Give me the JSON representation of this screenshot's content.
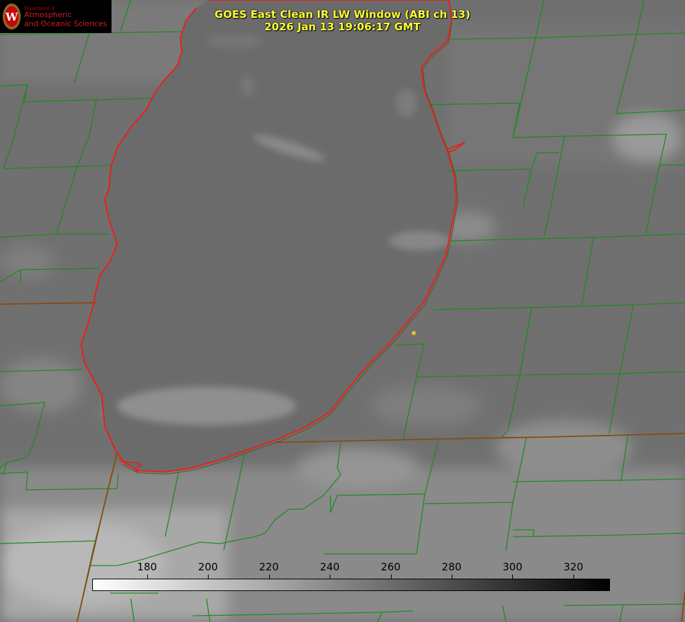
{
  "title": {
    "line1": "GOES East Clean IR LW Window (ABI ch 13)",
    "line2": "2026 Jan 13 19:06:17 GMT"
  },
  "logo": {
    "dept": "Department of",
    "line1": "Atmospheric",
    "line2": "and Oceanic Sciences",
    "seal_letter": "W"
  },
  "colorbar": {
    "ticks": [
      "180",
      "200",
      "220",
      "240",
      "260",
      "280",
      "300",
      "320"
    ],
    "range": [
      162,
      332
    ],
    "gradient": [
      "#ffffff",
      "#000000"
    ],
    "units": ""
  },
  "colors": {
    "lake_outline": "#e8201a",
    "boundaries": "#1f8a1f",
    "state_line": "#8a4a10",
    "marker": "#e8c020",
    "title": "#ffff33"
  }
}
